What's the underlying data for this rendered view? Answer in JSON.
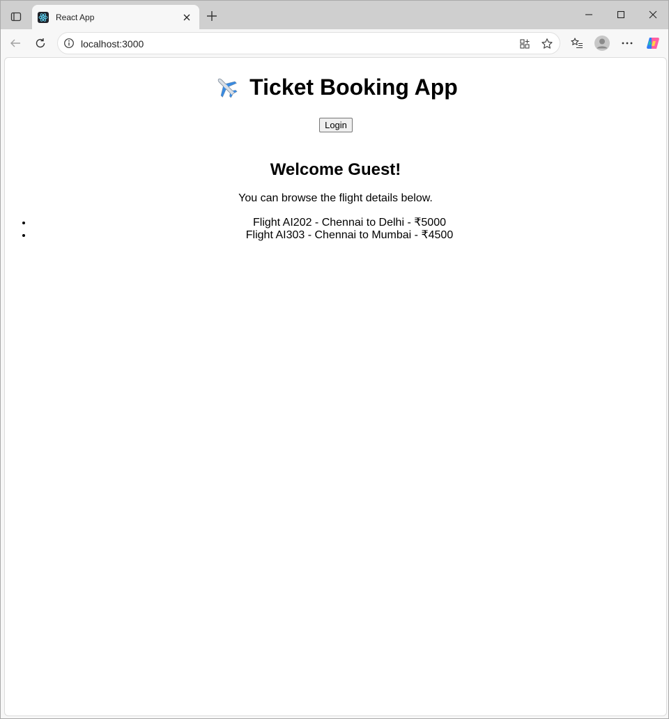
{
  "browser": {
    "tab_title": "React App",
    "url": "localhost:3000"
  },
  "page": {
    "heading": "Ticket Booking App",
    "heading_emoji": "airplane",
    "login_label": "Login",
    "welcome": "Welcome Guest!",
    "subtitle": "You can browse the flight details below.",
    "flights": [
      "Flight AI202 - Chennai to Delhi - ₹5000",
      "Flight AI303 - Chennai to Mumbai - ₹4500"
    ]
  },
  "colors": {
    "tabstrip": "#cfcfcf",
    "toolbar": "#f7f7f7",
    "react_blue": "#61dafb"
  }
}
